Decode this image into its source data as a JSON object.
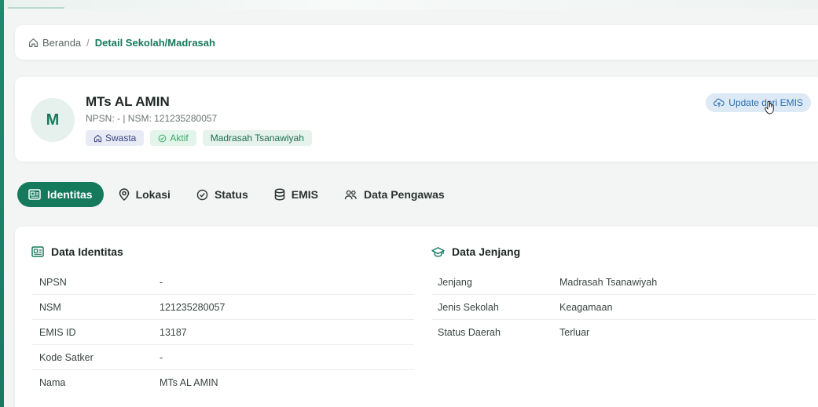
{
  "breadcrumb": {
    "home": "Beranda",
    "separator": "/",
    "current": "Detail Sekolah/Madrasah"
  },
  "school": {
    "avatar_letter": "M",
    "name": "MTs AL AMIN",
    "codes": "NPSN: - | NSM: 121235280057",
    "badges": {
      "type": "Swasta",
      "status": "Aktif",
      "level": "Madrasah Tsanawiyah"
    },
    "update_button": "Update dari EMIS"
  },
  "tabs": [
    {
      "label": "Identitas",
      "icon": "id-card-icon",
      "active": true
    },
    {
      "label": "Lokasi",
      "icon": "map-pin-icon",
      "active": false
    },
    {
      "label": "Status",
      "icon": "check-circle-icon",
      "active": false
    },
    {
      "label": "EMIS",
      "icon": "database-icon",
      "active": false
    },
    {
      "label": "Data Pengawas",
      "icon": "users-icon",
      "active": false
    }
  ],
  "identitas": {
    "title": "Data Identitas",
    "rows": [
      {
        "key": "NPSN",
        "value": "-"
      },
      {
        "key": "NSM",
        "value": "121235280057"
      },
      {
        "key": "EMIS ID",
        "value": "13187"
      },
      {
        "key": "Kode Satker",
        "value": "-"
      },
      {
        "key": "Nama",
        "value": "MTs AL AMIN"
      }
    ]
  },
  "jenjang": {
    "title": "Data Jenjang",
    "rows": [
      {
        "key": "Jenjang",
        "value": "Madrasah Tsanawiyah"
      },
      {
        "key": "Jenis Sekolah",
        "value": "Keagamaan"
      },
      {
        "key": "Status Daerah",
        "value": "Terluar"
      }
    ]
  },
  "colors": {
    "brand": "#157a5c",
    "accent_blue": "#2d6fb2"
  }
}
